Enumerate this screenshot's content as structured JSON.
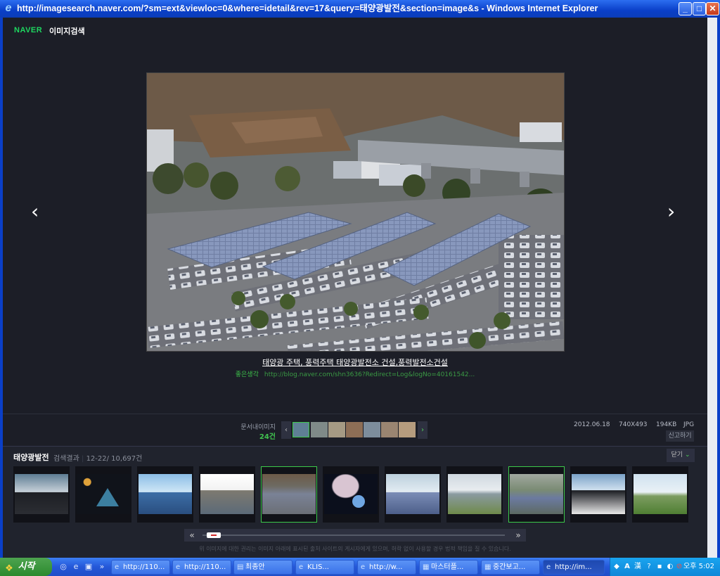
{
  "window": {
    "title": "http://imagesearch.naver.com/?sm=ext&viewloc=0&where=idetail&rev=17&query=태양광발전&section=image&s - Windows Internet Explorer",
    "buttons": {
      "minimize": "_",
      "maximize": "□",
      "close": "✕"
    }
  },
  "logo": {
    "brand": "NAVER",
    "service": "이미지검색"
  },
  "viewer": {
    "prev_glyph": "‹",
    "next_glyph": "›",
    "caption": "태양광 주택, 풍력주택 태양광발전소 건설,풍력발전소건설",
    "source_name": "좋은생각",
    "source_url": "http://blog.naver.com/shn3636?Redirect=Log&logNo=40161542..."
  },
  "related_strip": {
    "label": "문서내이미지",
    "count": "24건",
    "prev": "‹",
    "next": "›"
  },
  "meta": {
    "date": "2012.06.18",
    "dimensions": "740X493",
    "size": "194KB",
    "format": "JPG",
    "report_label": "신고하기"
  },
  "results": {
    "query": "태양광발전",
    "label": "검색결과",
    "range": "12-22/ 10,697건",
    "close_label": "닫기",
    "close_chevron": "⌄"
  },
  "slider": {
    "prev": "«",
    "next": "»"
  },
  "disclaimer": "위 이미지에 대한 권리는 이미지 아래에 표시된 출처 사이트의 게시자에게 있으며, 허락 없이 사용할 경우 법적 책임을 질 수 있습니다.",
  "taskbar": {
    "start_label": "시작",
    "tasks": [
      {
        "label": "http://110...",
        "icon": "ie-icon"
      },
      {
        "label": "http://110...",
        "icon": "ie-icon"
      },
      {
        "label": "최종안",
        "icon": "folder-icon"
      },
      {
        "label": "KLIS...",
        "icon": "ie-icon"
      },
      {
        "label": "http://w...",
        "icon": "ie-icon"
      },
      {
        "label": "마스터플...",
        "icon": "pdf-icon"
      },
      {
        "label": "중간보고...",
        "icon": "pdf-icon"
      },
      {
        "label": "http://im...",
        "icon": "ie-icon"
      }
    ],
    "tray_ime": "A",
    "tray_hanja": "漢",
    "clock": "오후 5:02"
  },
  "colors": {
    "accent_green": "#3cc94a",
    "background": "#1c1e27",
    "titlebar_blue": "#0a3fc8"
  }
}
